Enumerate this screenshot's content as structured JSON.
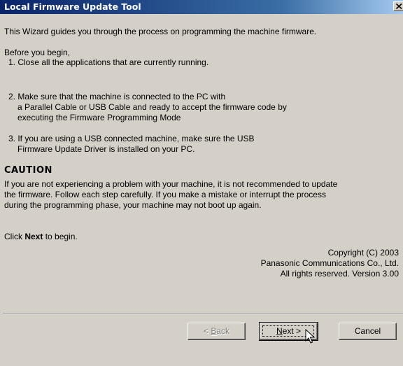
{
  "window": {
    "title": "Local Firmware Update Tool"
  },
  "content": {
    "intro": "This Wizard guides you through the process on programming the machine firmware.",
    "before_begin": "Before you begin,",
    "step1": "1.  Close all the applications that are currently running.",
    "step2_line1": "2.  Make sure that the machine is connected to the PC with",
    "step2_line2": "a Parallel Cable or USB Cable and ready to accept the firmware code by",
    "step2_line3": "executing the Firmware Programming Mode",
    "step3_line1": "3.  If you are using a USB connected machine, make sure the USB",
    "step3_line2": "Firmware Update Driver is installed on your PC.",
    "caution_heading": "CAUTION",
    "caution_line1": "If you are not experiencing a problem with your machine, it is not recommended to update",
    "caution_line2": "the firmware. Follow each step carefully. If you make a mistake or interrupt the process",
    "caution_line3": "during the programming phase, your machine may not boot up again.",
    "click_prefix": "Click ",
    "click_bold": "Next",
    "click_suffix": " to begin.",
    "copyright_line1": "Copyright (C) 2003",
    "copyright_line2": "Panasonic Communications Co., Ltd.",
    "copyright_line3": "All rights reserved. Version 3.00"
  },
  "buttons": {
    "back_prefix": "< ",
    "back_accel": "B",
    "back_rest": "ack",
    "next_accel": "N",
    "next_rest": "ext >",
    "cancel": "Cancel"
  },
  "icons": {
    "close": "close-icon",
    "cursor": "mouse-pointer-icon"
  }
}
